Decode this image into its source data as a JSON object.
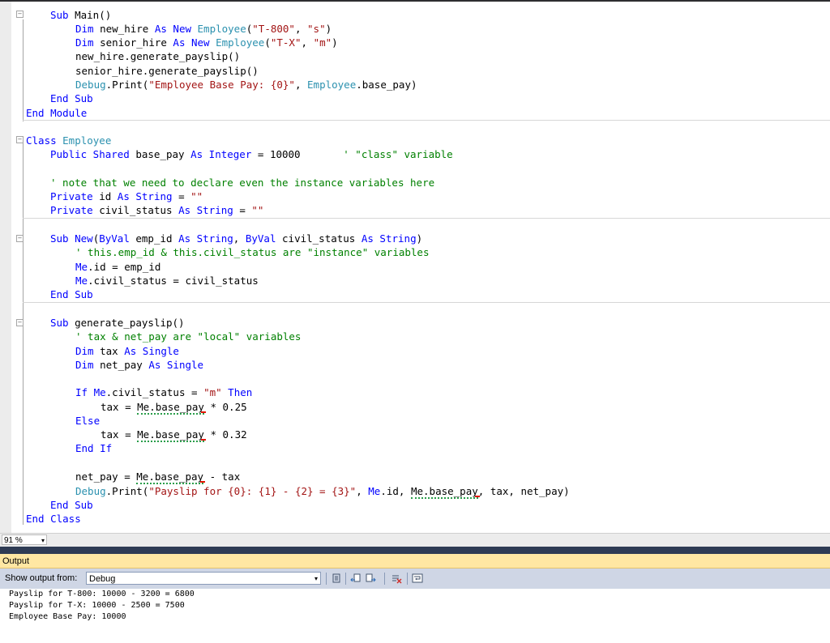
{
  "editor": {
    "lines": {
      "l1": {
        "a": "Sub ",
        "b": "Main()"
      },
      "l2": {
        "a": "Dim ",
        "b": "new_hire ",
        "c": "As New ",
        "d": "Employee",
        "e": "(",
        "f": "\"T-800\"",
        "g": ", ",
        "h": "\"s\"",
        "i": ")"
      },
      "l3": {
        "a": "Dim ",
        "b": "senior_hire ",
        "c": "As New ",
        "d": "Employee",
        "e": "(",
        "f": "\"T-X\"",
        "g": ", ",
        "h": "\"m\"",
        "i": ")"
      },
      "l4": {
        "a": "new_hire.generate_payslip()"
      },
      "l5": {
        "a": "senior_hire.generate_payslip()"
      },
      "l6": {
        "a": "Debug",
        "b": ".Print(",
        "c": "\"Employee Base Pay: {0}\"",
        "d": ", ",
        "e": "Employee",
        "f": ".base_pay)"
      },
      "l7": {
        "a": "End Sub"
      },
      "l8": {
        "a": "End Module"
      },
      "l9": {
        "a": "Class ",
        "b": "Employee"
      },
      "l10": {
        "a": "Public Shared ",
        "b": "base_pay ",
        "c": "As Integer ",
        "d": "= 10000       ",
        "e": "' \"class\" variable"
      },
      "l11": {
        "a": "' note that we need to declare even the instance variables here"
      },
      "l12": {
        "a": "Private ",
        "b": "id ",
        "c": "As String ",
        "d": "= ",
        "e": "\"\""
      },
      "l13": {
        "a": "Private ",
        "b": "civil_status ",
        "c": "As String ",
        "d": "= ",
        "e": "\"\""
      },
      "l14": {
        "a": "Sub New",
        "b": "(",
        "c": "ByVal ",
        "d": "emp_id ",
        "e": "As String",
        "f": ", ",
        "g": "ByVal ",
        "h": "civil_status ",
        "i": "As String",
        "j": ")"
      },
      "l15": {
        "a": "' this.emp_id & this.civil_status are \"instance\" variables"
      },
      "l16": {
        "a": "Me",
        "b": ".id = emp_id"
      },
      "l17": {
        "a": "Me",
        "b": ".civil_status = civil_status"
      },
      "l18": {
        "a": "End Sub"
      },
      "l19": {
        "a": "Sub ",
        "b": "generate_payslip()"
      },
      "l20": {
        "a": "' tax & net_pay are \"local\" variables"
      },
      "l21": {
        "a": "Dim ",
        "b": "tax ",
        "c": "As Single"
      },
      "l22": {
        "a": "Dim ",
        "b": "net_pay ",
        "c": "As Single"
      },
      "l23": {
        "a": "If ",
        "b": "Me",
        "c": ".civil_status = ",
        "d": "\"m\" ",
        "e": "Then"
      },
      "l24": {
        "a": "tax = ",
        "b": "Me.base_pay",
        "c": " * 0.25"
      },
      "l25": {
        "a": "Else"
      },
      "l26": {
        "a": "tax = ",
        "b": "Me.base_pay",
        "c": " * 0.32"
      },
      "l27": {
        "a": "End If"
      },
      "l28": {
        "a": "net_pay = ",
        "b": "Me.base_pay",
        "c": " - tax"
      },
      "l29": {
        "a": "Debug",
        "b": ".Print(",
        "c": "\"Payslip for {0}: {1} - {2} = {3}\"",
        "d": ", ",
        "e": "Me",
        "f": ".id, ",
        "g": "Me.base_pay",
        "h": ", tax, net_pay)"
      },
      "l30": {
        "a": "End Sub"
      },
      "l31": {
        "a": "End Class"
      }
    },
    "fold_symbol_expanded": "−"
  },
  "zoom": {
    "value": "91 %",
    "arrow": "▾"
  },
  "output": {
    "title": "Output",
    "show_from_label": "Show output from:",
    "source_selected": "Debug",
    "dropdown_arrow": "▾",
    "lines": [
      "Payslip for T-800: 10000 - 3200 = 6800",
      "Payslip for T-X: 10000 - 2500 = 7500",
      "Employee Base Pay: 10000"
    ]
  },
  "toolbar_icons": [
    "go-to-location-icon",
    "previous-message-icon",
    "next-message-icon",
    "clear-all-icon",
    "toggle-word-wrap-icon"
  ],
  "colors": {
    "keyword": "#0000ff",
    "type": "#2b91af",
    "string": "#a31515",
    "comment": "#008000",
    "output_header": "#ffe7a3",
    "toolbar": "#cfd6e5"
  }
}
